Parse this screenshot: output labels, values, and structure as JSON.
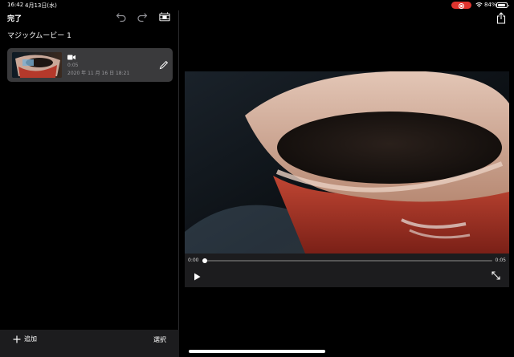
{
  "status": {
    "time": "16:42",
    "date": "4月13日(水)",
    "battery": "84%"
  },
  "toolbar": {
    "done_label": "完了"
  },
  "project": {
    "title": "マジックムービー 1"
  },
  "clip": {
    "duration": "0:05",
    "date": "2020 年 11 月 16 日 18:21"
  },
  "bottom_bar": {
    "add_label": "追加",
    "select_label": "選択"
  },
  "player": {
    "current_time": "0:00",
    "total_time": "0:05",
    "progress": 0
  },
  "colors": {
    "record_indicator": "#e0342e",
    "card_background": "#3a3a3c",
    "bar_background": "#1c1c1e"
  }
}
